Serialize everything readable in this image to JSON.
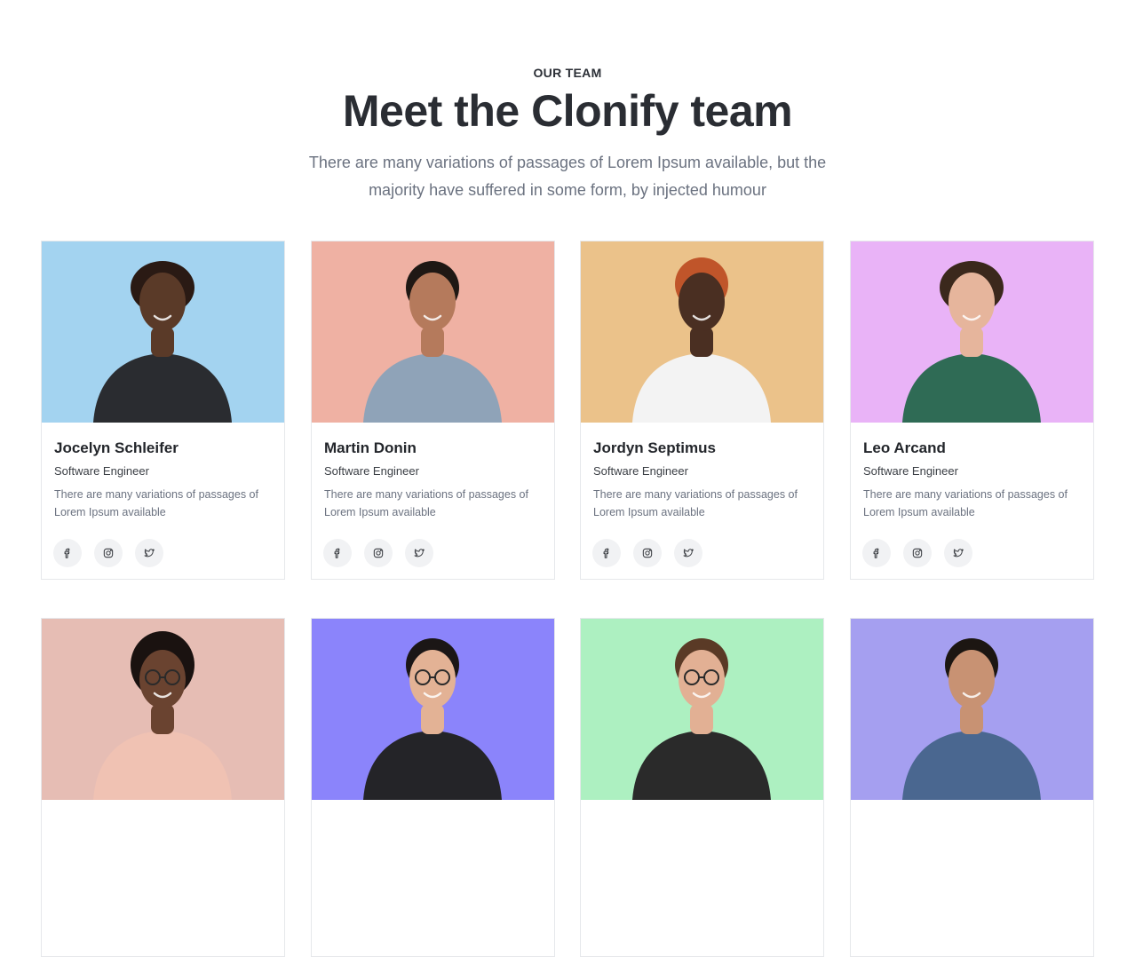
{
  "header": {
    "eyebrow": "OUR TEAM",
    "title": "Meet the Clonify team",
    "subtitle": "There are many variations of passages of Lorem Ipsum available, but the majority have suffered in some form, by injected humour"
  },
  "members": [
    {
      "name": "Jocelyn Schleifer",
      "role": "Software Engineer",
      "desc": "There are many variations of passages of Lorem Ipsum available",
      "bg": "#a3d3f0",
      "skin": "#5a3a28",
      "hair": "#2a1a14",
      "shirt": "#2a2c30"
    },
    {
      "name": "Martin Donin",
      "role": "Software Engineer",
      "desc": "There are many variations of passages of Lorem Ipsum available",
      "bg": "#efb1a3",
      "skin": "#b57a5c",
      "hair": "#1f1814",
      "shirt": "#8fa3b8"
    },
    {
      "name": "Jordyn Septimus",
      "role": "Software Engineer",
      "desc": "There are many variations of passages of Lorem Ipsum available",
      "bg": "#ebc28a",
      "skin": "#4a2f22",
      "hair": "#c0552a",
      "shirt": "#f3f3f3"
    },
    {
      "name": "Leo Arcand",
      "role": "Software Engineer",
      "desc": "There are many variations of passages of Lorem Ipsum available",
      "bg": "#e9b3f7",
      "skin": "#e6b59c",
      "hair": "#3b281c",
      "shirt": "#2f6b55"
    },
    {
      "name": "",
      "role": "",
      "desc": "",
      "bg": "#e6bdb4",
      "skin": "#6a4330",
      "hair": "#1a1210",
      "shirt": "#f0c2b3"
    },
    {
      "name": "",
      "role": "",
      "desc": "",
      "bg": "#8b84fb",
      "skin": "#e3b295",
      "hair": "#1b1616",
      "shirt": "#242428"
    },
    {
      "name": "",
      "role": "",
      "desc": "",
      "bg": "#adf0c1",
      "skin": "#e2b094",
      "hair": "#5a3a26",
      "shirt": "#2a2a2a"
    },
    {
      "name": "",
      "role": "",
      "desc": "",
      "bg": "#a59ff0",
      "skin": "#c89273",
      "hair": "#1c1612",
      "shirt": "#4a6790"
    }
  ],
  "social_icons": [
    "facebook-icon",
    "instagram-icon",
    "twitter-icon"
  ]
}
